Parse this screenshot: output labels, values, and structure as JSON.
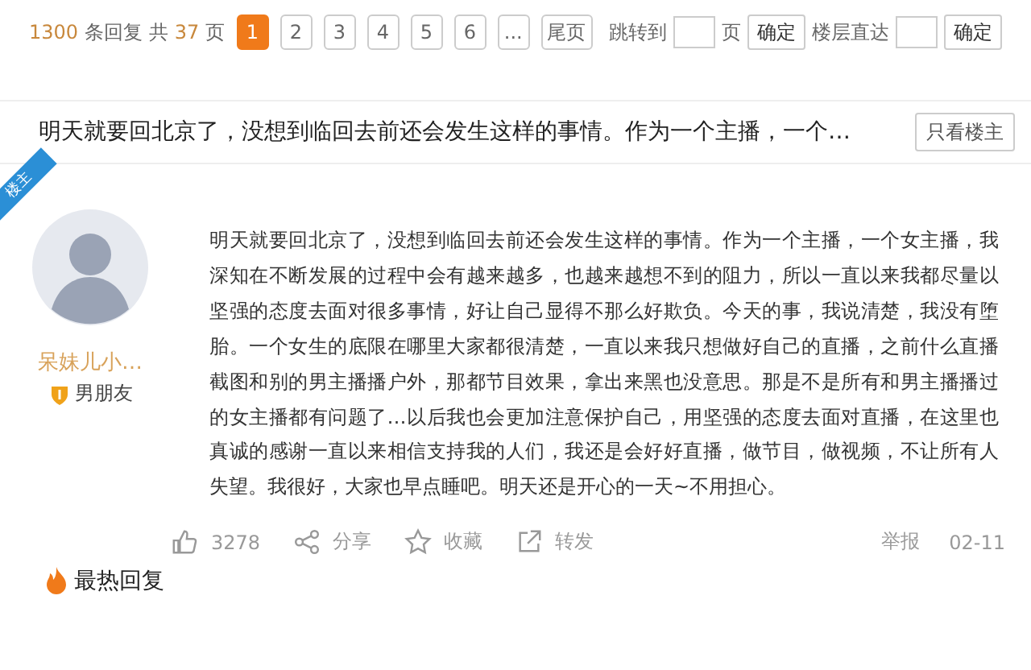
{
  "pager": {
    "total_replies": "1300",
    "replies_label": "条回复 共",
    "total_pages": "37",
    "pages_label": "页",
    "pages": [
      {
        "label": "1",
        "selected": true
      },
      {
        "label": "2",
        "selected": false
      },
      {
        "label": "3",
        "selected": false
      },
      {
        "label": "4",
        "selected": false
      },
      {
        "label": "5",
        "selected": false
      },
      {
        "label": "6",
        "selected": false
      },
      {
        "label": "...",
        "selected": false
      },
      {
        "label": "尾页",
        "selected": false
      }
    ],
    "jump_label": "跳转到",
    "jump_unit": "页",
    "jump_button": "确定",
    "floor_label": "楼层直达",
    "floor_button": "确定"
  },
  "thread": {
    "title": "明天就要回北京了，没想到临回去前还会发生这样的事情。作为一个主播，一个…",
    "author_only_button": "只看楼主"
  },
  "post": {
    "badge": "楼主",
    "author": "呆妹儿小…",
    "medal": "男朋友",
    "text": "明天就要回北京了，没想到临回去前还会发生这样的事情。作为一个主播，一个女主播，我深知在不断发展的过程中会有越来越多，也越来越想不到的阻力，所以一直以来我都尽量以坚强的态度去面对很多事情，好让自己显得不那么好欺负。今天的事，我说清楚，我没有堕胎。一个女生的底限在哪里大家都很清楚，一直以来我只想做好自己的直播，之前什么直播截图和别的男主播播户外，那都节目效果，拿出来黑也没意思。那是不是所有和男主播播过的女主播都有问题了…以后我也会更加注意保护自己，用坚强的态度去面对直播，在这里也真诚的感谢一直以来相信支持我的人们，我还是会好好直播，做节目，做视频，不让所有人失望。我很好，大家也早点睡吧。明天还是开心的一天~不用担心。",
    "actions": [
      {
        "kind": "like",
        "label": "3278"
      },
      {
        "kind": "share",
        "label": "分享"
      },
      {
        "kind": "favorite",
        "label": "收藏"
      },
      {
        "kind": "forward",
        "label": "转发"
      }
    ],
    "report": "举报",
    "date": "02-11"
  },
  "hot_replies": {
    "title": "最热回复"
  }
}
